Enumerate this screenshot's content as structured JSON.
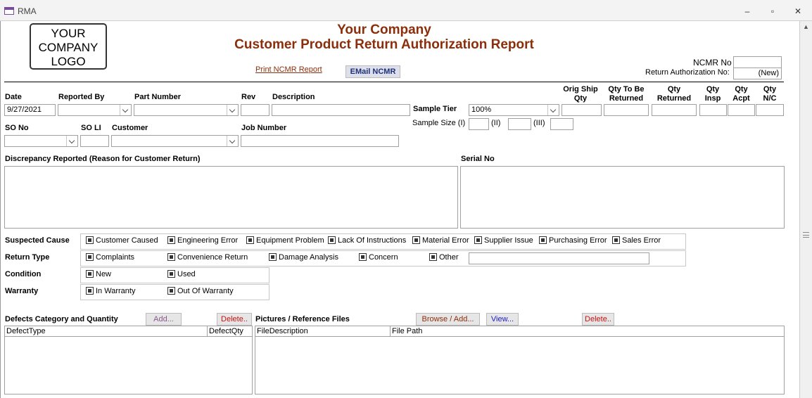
{
  "window": {
    "title": "RMA",
    "minimize": "‒",
    "restore": "▫",
    "close": "✕"
  },
  "header": {
    "logo_lines": [
      "YOUR",
      "COMPANY",
      "LOGO"
    ],
    "company": "Your Company",
    "title": "Customer Product Return Authorization Report",
    "print_link": "Print NCMR Report",
    "email_button": "EMail NCMR",
    "ncmr_label": "NCMR No",
    "ncmr_value": "",
    "ra_label": "Return Authorization No:",
    "ra_value": "(New)"
  },
  "row1": {
    "date_label": "Date",
    "date_value": "9/27/2021",
    "reported_by_label": "Reported By",
    "part_number_label": "Part Number",
    "rev_label": "Rev",
    "description_label": "Description",
    "sample_tier_label": "Sample Tier",
    "sample_tier_value": "100%",
    "sample_size_label": "Sample Size (I)",
    "sample_ii": "(II)",
    "sample_iii": "(III)"
  },
  "qty_headers": {
    "orig_ship": [
      "Orig Ship",
      "Qty"
    ],
    "to_be_returned": [
      "Qty To Be",
      "Returned"
    ],
    "returned": [
      "Qty",
      "Returned"
    ],
    "insp": [
      "Qty",
      "Insp"
    ],
    "acpt": [
      "Qty",
      "Acpt"
    ],
    "nc": [
      "Qty",
      "N/C"
    ]
  },
  "row2": {
    "so_no_label": "SO No",
    "so_li_label": "SO LI",
    "customer_label": "Customer",
    "job_number_label": "Job Number"
  },
  "discrepancy_label": "Discrepancy Reported (Reason for Customer Return)",
  "serial_label": "Serial No",
  "suspected_cause": {
    "label": "Suspected Cause",
    "options": [
      "Customer Caused",
      "Engineering Error",
      "Equipment Problem",
      "Lack Of Instructions",
      "Material Error",
      "Supplier Issue",
      "Purchasing Error",
      "Sales Error"
    ]
  },
  "return_type": {
    "label": "Return Type",
    "options": [
      "Complaints",
      "Convenience Return",
      "Damage Analysis",
      "Concern",
      "Other"
    ]
  },
  "condition": {
    "label": "Condition",
    "options": [
      "New",
      "Used"
    ]
  },
  "warranty": {
    "label": "Warranty",
    "options": [
      "In Warranty",
      "Out Of Warranty"
    ]
  },
  "defects": {
    "label": "Defects Category and Quantity",
    "add": "Add...",
    "delete": "Delete..",
    "columns": [
      "DefectType",
      "DefectQty"
    ]
  },
  "pictures": {
    "label": "Pictures / Reference Files",
    "browse": "Browse / Add...",
    "view": "View...",
    "delete": "Delete..",
    "columns": [
      "FileDescription",
      "File Path"
    ]
  },
  "colors": {
    "brand": "#8b2e0b",
    "email_btn_text": "#1f2f7a",
    "view_btn_text": "#1a1acc",
    "delete_btn_text": "#cc1111",
    "browse_btn_text": "#8b2e0b",
    "add_btn_text": "#8a5a8a"
  }
}
